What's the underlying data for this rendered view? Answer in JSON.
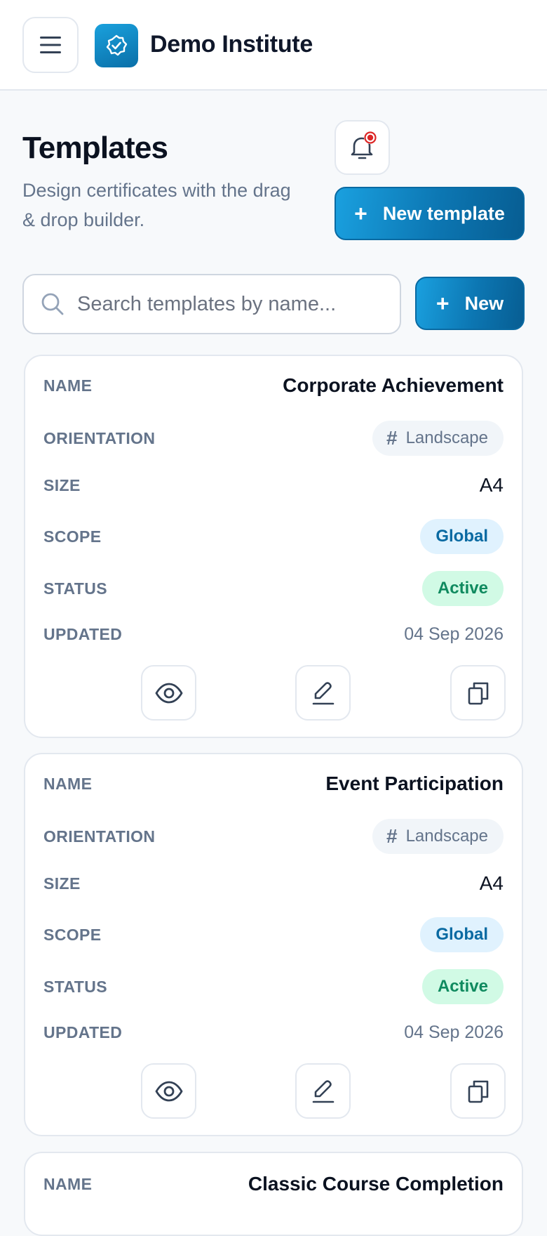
{
  "header": {
    "app_title": "Demo Institute",
    "logo_icon": "badge-check-icon",
    "menu_icon": "hamburger-menu-icon"
  },
  "page": {
    "title": "Templates",
    "subtitle": "Design certificates with the drag & drop builder.",
    "notification_icon": "bell-icon"
  },
  "buttons": {
    "new_template_label": "New template",
    "new_label": "New",
    "plus": "+"
  },
  "search": {
    "placeholder": "Search templates by name..."
  },
  "columns": {
    "name": "NAME",
    "orientation": "ORIENTATION",
    "size": "SIZE",
    "scope": "SCOPE",
    "status": "STATUS",
    "updated": "UPDATED"
  },
  "templates": [
    {
      "name": "Corporate Achievement",
      "orientation": "Landscape",
      "size": "A4",
      "scope": "Global",
      "status": "Active",
      "updated": "04 Sep 2026"
    },
    {
      "name": "Event Participation",
      "orientation": "Landscape",
      "size": "A4",
      "scope": "Global",
      "status": "Active",
      "updated": "04 Sep 2026"
    },
    {
      "name": "Classic Course Completion"
    }
  ],
  "colors": {
    "accent": "#0c76b2",
    "status_active_bg": "#d1fae5",
    "status_active_text": "#0f8a5f",
    "scope_bg": "#e0f2fe",
    "notification_dot": "#dc2626"
  }
}
